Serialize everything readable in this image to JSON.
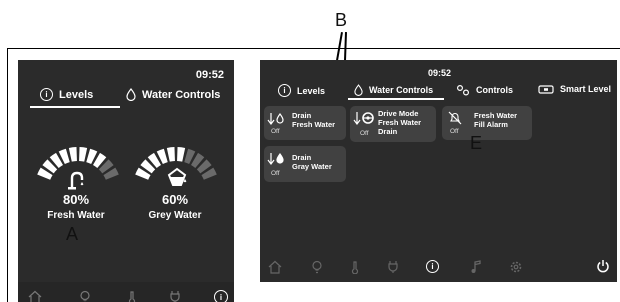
{
  "callouts": {
    "a": "A",
    "b": "B",
    "e": "E"
  },
  "left_screen": {
    "time": "09:52",
    "tabs": [
      {
        "label": "Levels",
        "icon": "info-icon"
      },
      {
        "label": "Water Controls",
        "icon": "drop-icon"
      }
    ],
    "gauges": [
      {
        "value": "80%",
        "label": "Fresh Water",
        "level": 0.8,
        "icon": "faucet-icon"
      },
      {
        "value": "60%",
        "label": "Grey Water",
        "level": 0.6,
        "icon": "bucket-icon"
      }
    ],
    "nav_icons": [
      "home-icon",
      "bulb-icon",
      "thermometer-icon",
      "power-plug-icon",
      "info-icon"
    ]
  },
  "right_screen": {
    "time": "09:52",
    "tabs": [
      {
        "label": "Levels",
        "icon": "info-icon"
      },
      {
        "label": "Water Controls",
        "icon": "drop-icon"
      },
      {
        "label": "Controls",
        "icon": "gears-icon"
      },
      {
        "label": "Smart Level",
        "icon": "level-icon"
      }
    ],
    "cards": [
      {
        "title_line1": "Drain",
        "title_line2": "Fresh Water",
        "title_line3": "",
        "status": "Off",
        "icon": "drain-drop-icon"
      },
      {
        "title_line1": "Drive Mode",
        "title_line2": "Fresh Water",
        "title_line3": "Drain",
        "status": "Off",
        "icon": "steering-wheel-icon"
      },
      {
        "title_line1": "Fresh Water",
        "title_line2": "Fill Alarm",
        "title_line3": "",
        "status": "Off",
        "icon": "alarm-muted-icon"
      },
      {
        "title_line1": "Drain",
        "title_line2": "Gray Water",
        "title_line3": "",
        "status": "Off",
        "icon": "drain-drop-icon"
      }
    ],
    "nav_icons": [
      "home-icon",
      "bulb-icon",
      "thermometer-icon",
      "power-plug-icon",
      "info-icon",
      "music-icon",
      "gear-icon",
      "power-icon"
    ]
  },
  "colors": {
    "screen_bg": "#2b2b2b",
    "card_bg": "#414141",
    "gauge_on": "#ffffff",
    "gauge_off": "#6a6a6a"
  }
}
